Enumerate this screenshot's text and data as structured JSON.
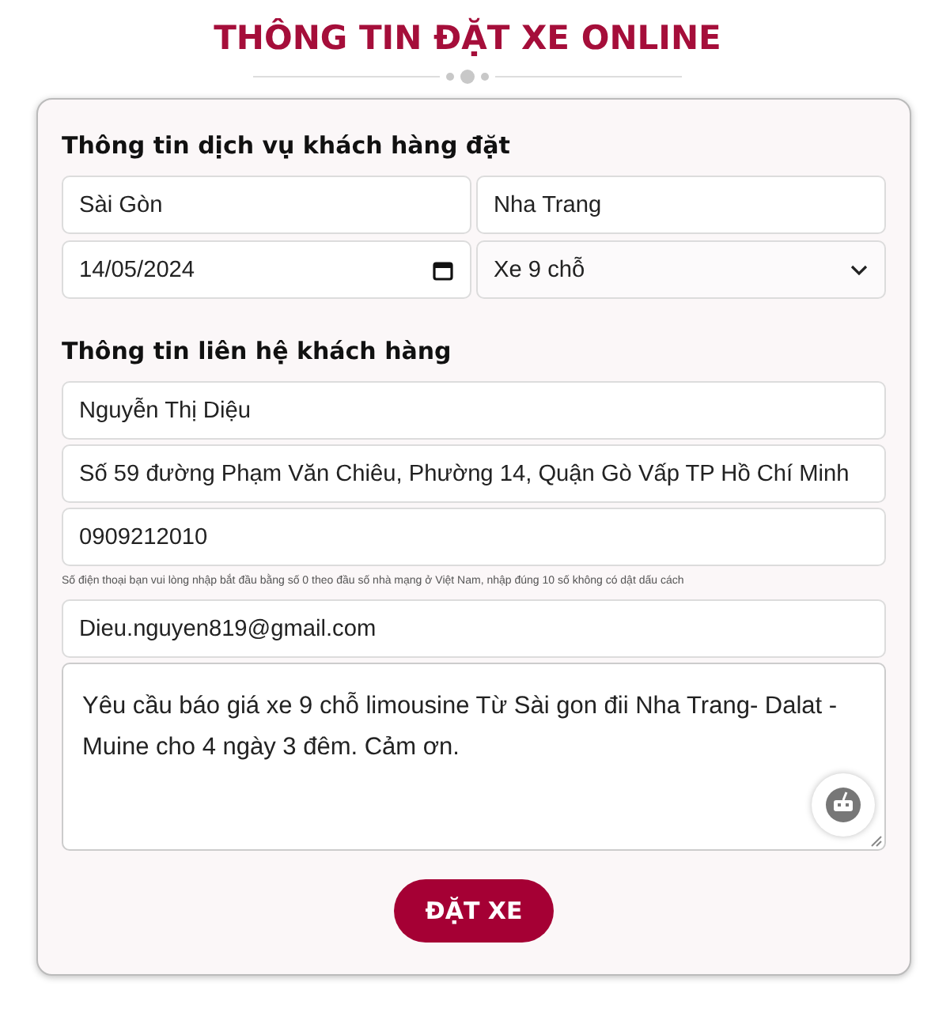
{
  "title": "THÔNG TIN ĐẶT XE ONLINE",
  "service": {
    "heading": "Thông tin dịch vụ khách hàng đặt",
    "pickup": "Sài Gòn",
    "destination": "Nha Trang",
    "date": "14/05/2024",
    "vehicle": "Xe 9 chỗ"
  },
  "contact": {
    "heading": "Thông tin liên hệ khách hàng",
    "name": "Nguyễn Thị Diệu",
    "address": "Số 59 đường Phạm Văn Chiêu, Phường 14, Quận Gò Vấp TP Hồ Chí Minh",
    "phone": "0909212010",
    "phone_hint": "Số điện thoại bạn vui lòng nhập bắt đầu bằng số 0 theo đầu số nhà mạng ở Việt Nam, nhập đúng 10 số không có dật dấu cách",
    "email": "Dieu.nguyen819@gmail.com",
    "message": "Yêu cầu báo giá xe 9 chỗ limousine Từ Sài gon đii Nha Trang- Dalat - Muine cho 4 ngày 3 đêm. Cảm ơn."
  },
  "submit": "ĐẶT XE"
}
